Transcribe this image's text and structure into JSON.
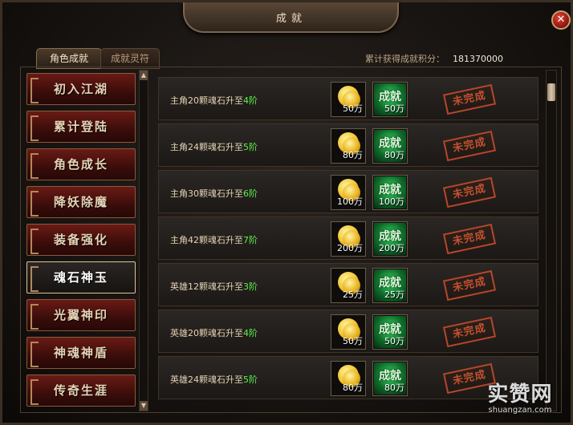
{
  "window": {
    "title": "成 就"
  },
  "tabs": [
    {
      "label": "角色成就",
      "active": true
    },
    {
      "label": "成就灵符",
      "active": false
    }
  ],
  "points": {
    "label": "累计获得成就积分：",
    "value": "181370000"
  },
  "categories": [
    {
      "label": "初入江湖"
    },
    {
      "label": "累计登陆"
    },
    {
      "label": "角色成长"
    },
    {
      "label": "降妖除魔"
    },
    {
      "label": "装备强化"
    },
    {
      "label": "魂石神玉",
      "active": true
    },
    {
      "label": "光翼神印"
    },
    {
      "label": "神魂神盾"
    },
    {
      "label": "传奇生涯"
    }
  ],
  "achievement_word": "成就",
  "status_stamp": "未完成",
  "rows": [
    {
      "title_pre": "主角20颗魂石升至",
      "title_lvl": "4阶",
      "gold": "50万",
      "ach": "50万"
    },
    {
      "title_pre": "主角24颗魂石升至",
      "title_lvl": "5阶",
      "gold": "80万",
      "ach": "80万"
    },
    {
      "title_pre": "主角30颗魂石升至",
      "title_lvl": "6阶",
      "gold": "100万",
      "ach": "100万"
    },
    {
      "title_pre": "主角42颗魂石升至",
      "title_lvl": "7阶",
      "gold": "200万",
      "ach": "200万"
    },
    {
      "title_pre": "英雄12颗魂石升至",
      "title_lvl": "3阶",
      "gold": "25万",
      "ach": "25万"
    },
    {
      "title_pre": "英雄20颗魂石升至",
      "title_lvl": "4阶",
      "gold": "50万",
      "ach": "50万"
    },
    {
      "title_pre": "英雄24颗魂石升至",
      "title_lvl": "5阶",
      "gold": "80万",
      "ach": "80万"
    }
  ],
  "watermark": {
    "big": "实赞网",
    "small": "shuangzan.com"
  },
  "icons": [
    "close-icon",
    "scroll-up-icon",
    "scroll-down-icon",
    "gold-coin-icon",
    "achievement-icon"
  ]
}
